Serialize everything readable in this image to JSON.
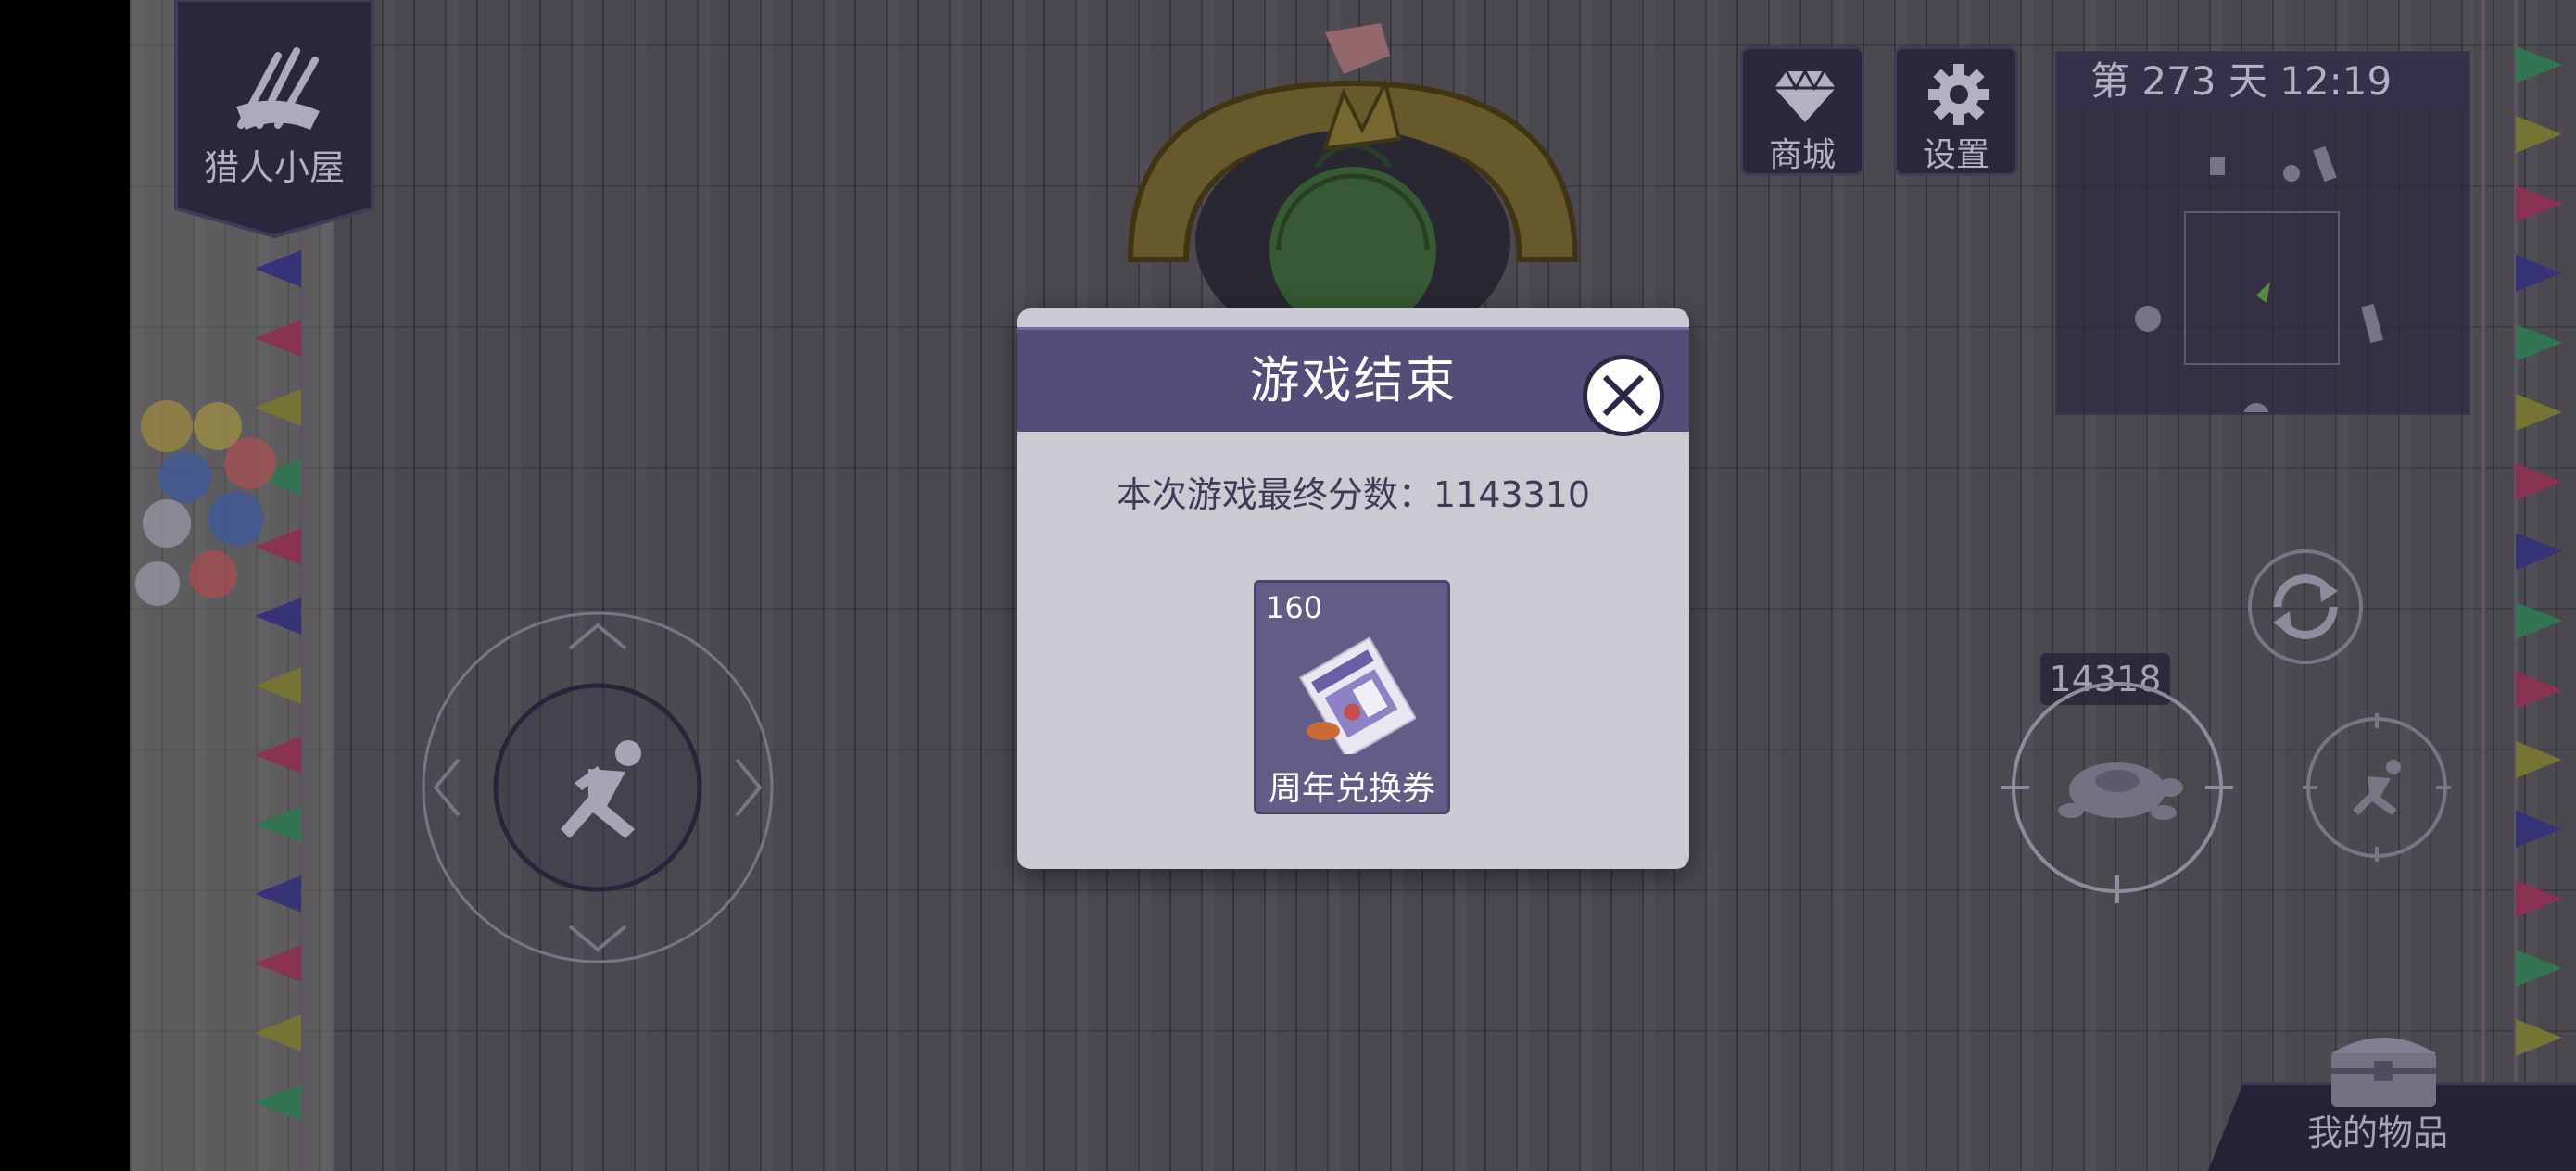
{
  "hud": {
    "hunter_house_label": "猎人小屋",
    "shop_label": "商城",
    "settings_label": "设置",
    "day_clock": "第 273 天   12:19",
    "score_badge": "14318",
    "my_items_label": "我的物品"
  },
  "dialog": {
    "title": "游戏结束",
    "score_text": "本次游戏最终分数：1143310",
    "reward": {
      "quantity": "160",
      "name": "周年兑换券"
    }
  },
  "colors": {
    "dialog_header": "#554c7a",
    "dialog_body": "#cbcad2",
    "item_tile": "#645b87",
    "hud_panel": "#302c44"
  },
  "icons": [
    "arrows-bundle-icon",
    "diamond-icon",
    "gear-icon",
    "close-icon",
    "running-man-icon",
    "refresh-icon",
    "turtle-mine-icon",
    "sprint-icon",
    "treasure-chest-icon",
    "coupon-icon"
  ]
}
